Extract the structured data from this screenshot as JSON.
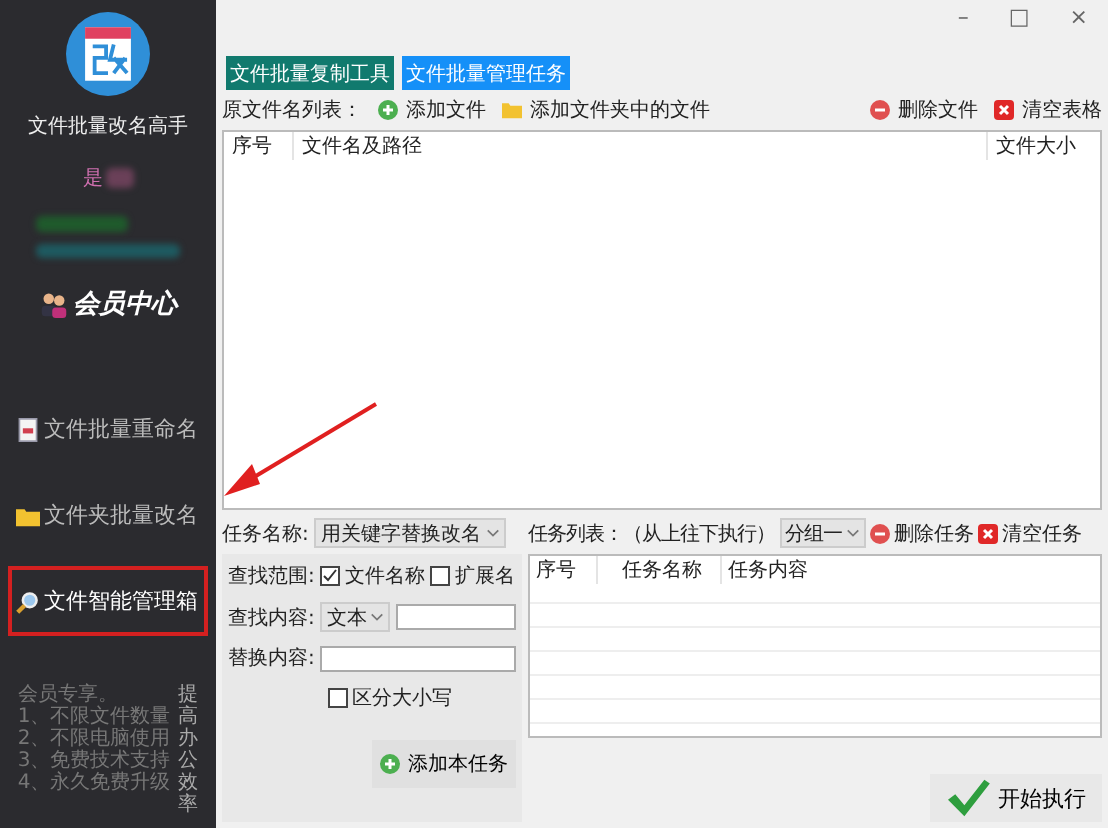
{
  "sidebar": {
    "app_title": "文件批量改名高手",
    "user_prefix": "是",
    "member_center": "会员中心",
    "items": [
      {
        "label": "文件批量重命名",
        "selected": false
      },
      {
        "label": "文件夹批量改名",
        "selected": false
      },
      {
        "label": "文件智能管理箱",
        "selected": true
      }
    ],
    "perks_title": "会员专享。",
    "perks": [
      "1、不限文件数量",
      "2、不限电脑使用",
      "3、免费技术支持",
      "4、永久免费升级"
    ],
    "slogan": "提高办公效率"
  },
  "window_controls": [
    "–",
    "□",
    "×"
  ],
  "tabs": [
    {
      "label": "文件批量复制工具",
      "selected": false
    },
    {
      "label": "文件批量管理任务",
      "selected": true
    }
  ],
  "file_toolbar": {
    "label": "原文件名列表：",
    "add_file": "添加文件",
    "add_folder": "添加文件夹中的文件",
    "delete": "删除文件",
    "clear": "清空表格"
  },
  "file_table": {
    "columns": [
      "序号",
      "文件名及路径",
      "文件大小"
    ]
  },
  "task_form": {
    "name_label": "任务名称:",
    "name_value": "用关键字替换改名",
    "scope_label": "查找范围:",
    "scope_options": [
      {
        "label": "文件名称",
        "checked": true
      },
      {
        "label": "扩展名",
        "checked": false
      }
    ],
    "find_label": "查找内容:",
    "find_type": "文本",
    "replace_label": "替换内容:",
    "case_option": {
      "label": "区分大小写",
      "checked": false
    },
    "add_button": "添加本任务"
  },
  "task_list": {
    "label": "任务列表：（从上往下执行）",
    "group": "分组一",
    "delete": "删除任务",
    "clear": "清空任务",
    "columns": [
      "序号",
      "任务名称",
      "任务内容"
    ]
  },
  "run_button": "开始执行"
}
